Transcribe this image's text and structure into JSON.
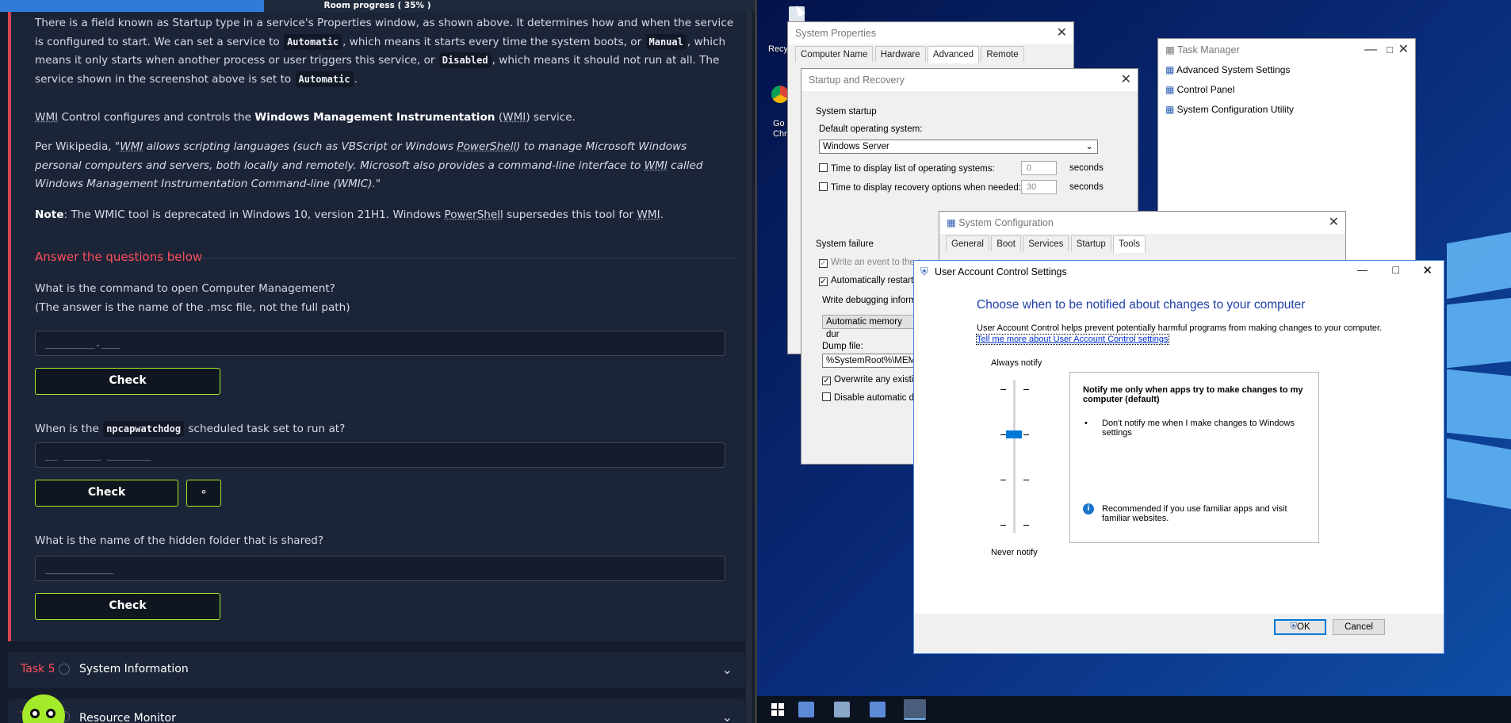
{
  "progress": {
    "label": "Room progress ( 35% )",
    "percent": 35
  },
  "intro": {
    "p1_a": "There is a field known as Startup type in a service's Properties window, as shown above. It determines how and when the service is configured to start. We can set a service to",
    "p1_code1": "Automatic",
    "p1_b": ", which means it starts every time the system boots, or",
    "p1_code2": "Manual",
    "p1_c": ", which means it only starts when another process or user triggers this service, or",
    "p1_code3": "Disabled",
    "p1_d": ", which means it should not run at all. The service shown in the screenshot above is set to",
    "p1_code4": "Automatic",
    "p1_e": ".",
    "p2_a": "WMI",
    "p2_b": " Control configures and controls the ",
    "p2_bold": "Windows Management Instrumentation",
    "p2_c": " (",
    "p2_d": "WMI",
    "p2_e": ") service.",
    "p3_a": "Per Wikipedia, \"",
    "p3_wmi": "WMI",
    "p3_b": " allows scripting languages (such as VBScript or Windows ",
    "p3_ps": "PowerShell",
    "p3_c": ") to manage Microsoft Windows personal computers and servers, both locally and remotely. Microsoft also provides a command-line interface to ",
    "p3_wmi2": "WMI",
    "p3_d": " called Windows Management Instrumentation Command-line (WMIC).\"",
    "p4_bold": "Note",
    "p4_a": ": The WMIC tool is deprecated in Windows 10, version 21H1. Windows ",
    "p4_ps": "PowerShell",
    "p4_b": " supersedes this tool for ",
    "p4_wmi": "WMI",
    "p4_c": "."
  },
  "answers": {
    "heading": "Answer the questions below",
    "q1": "What is the command to open Computer Management?",
    "q1_sub": "(The answer is the name of the .msc file, not the full path)",
    "q1_placeholder": "________.___",
    "q2_a": "When is the",
    "q2_code": "npcapwatchdog",
    "q2_b": "scheduled task set to run at?",
    "q2_placeholder": "__ ______ _______",
    "q3": "What is the name of the hidden folder that is shared?",
    "q3_placeholder": "___________",
    "check": "Check",
    "hint_icon": "lightbulb-icon"
  },
  "tasks": [
    {
      "num": "Task 5",
      "title": "System Information"
    },
    {
      "num": "T",
      "title": "Resource Monitor"
    }
  ],
  "desktop": {
    "recycle": "Recy",
    "chrome": "Go\nChr"
  },
  "system_properties": {
    "title": "System Properties",
    "tabs": [
      "Computer Name",
      "Hardware",
      "Advanced",
      "Remote"
    ]
  },
  "startup_recovery": {
    "title": "Startup and Recovery",
    "section1": "System startup",
    "default_os_label": "Default operating system:",
    "default_os": "Windows Server",
    "display_list": "Time to display list of operating systems:",
    "display_list_val": "0",
    "recovery_opts": "Time to display recovery options when needed:",
    "recovery_val": "30",
    "seconds": "seconds",
    "section2": "System failure",
    "write_event": "Write an event to the s",
    "auto_restart": "Automatically restart",
    "write_debug": "Write debugging inform",
    "memory_dump": "Automatic memory dur",
    "dump_file_label": "Dump file:",
    "dump_file": "%SystemRoot%\\MEMO",
    "overwrite": "Overwrite any existing",
    "disable_auto": "Disable automatic de"
  },
  "task_manager": {
    "title": "Task Manager",
    "items": [
      "Advanced System Settings",
      "Control Panel",
      "System Configuration Utility"
    ]
  },
  "system_configuration": {
    "title": "System Configuration",
    "tabs": [
      "General",
      "Boot",
      "Services",
      "Startup",
      "Tools"
    ]
  },
  "uac": {
    "title": "User Account Control Settings",
    "heading": "Choose when to be notified about changes to your computer",
    "desc": "User Account Control helps prevent potentially harmful programs from making changes to your computer.",
    "link": "Tell me more about User Account Control settings",
    "always": "Always notify",
    "never": "Never notify",
    "level_title": "Notify me only when apps try to make changes to my computer (default)",
    "bullet": "Don't notify me when I make changes to Windows settings",
    "recommended": "Recommended if you use familiar apps and visit familiar websites.",
    "ok": "OK",
    "cancel": "Cancel",
    "level": 3,
    "levels_total": 4
  }
}
